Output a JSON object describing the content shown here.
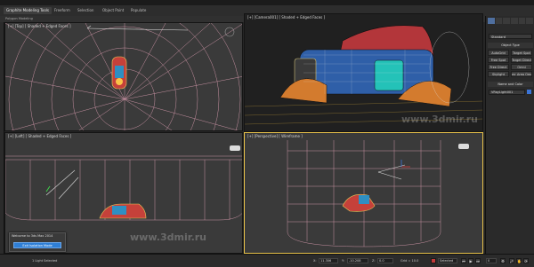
{
  "ribbon": {
    "tabs": [
      "Graphite Modeling Tools",
      "Freeform",
      "Selection",
      "Object Paint",
      "Populate"
    ],
    "active_tab_index": 0,
    "subpanel_label": "Polygon Modeling"
  },
  "viewports": {
    "top": {
      "label": "[+] [Top] [ Shaded + Edged Faces ]"
    },
    "camera": {
      "label": "[+] [Camera001] [ Shaded + Edged Faces ]",
      "watermark": "www.3dmir.ru"
    },
    "left": {
      "label": "[+] [Left] [ Shaded + Edged Faces ]",
      "watermark": "www.3dmir.ru"
    },
    "perspective": {
      "label": "[+] [Perspective] [ Wireframe ]"
    }
  },
  "command_panel": {
    "tabs": [
      "create-icon",
      "modify-icon",
      "hierarchy-icon",
      "motion-icon",
      "display-icon",
      "utilities-icon"
    ],
    "active_tab_index": 0,
    "dropdown_value": "Standard",
    "object_type_title": "Object Type",
    "buttons": [
      "AutoGrid",
      "Target Spot",
      "Free Spot",
      "Target Direct",
      "Free Direct",
      "Omni",
      "Skylight",
      "mr Area Omni"
    ],
    "name_color_title": "Name and Color",
    "name_value": "VRayLight001",
    "accent_color": "#3b74d6"
  },
  "dialog": {
    "title": "Welcome to 3ds Max 2014",
    "button_label": "Exit Isolation Mode"
  },
  "statusbar": {
    "selection_text": "1 Light Selected",
    "x_label": "X:",
    "x_value": "11.306",
    "y_label": "Y:",
    "y_value": "-10.208",
    "z_label": "Z:",
    "z_value": "0.0",
    "grid_text": "Grid = 10.0",
    "key_mode": "Selected",
    "frame_value": "0"
  }
}
